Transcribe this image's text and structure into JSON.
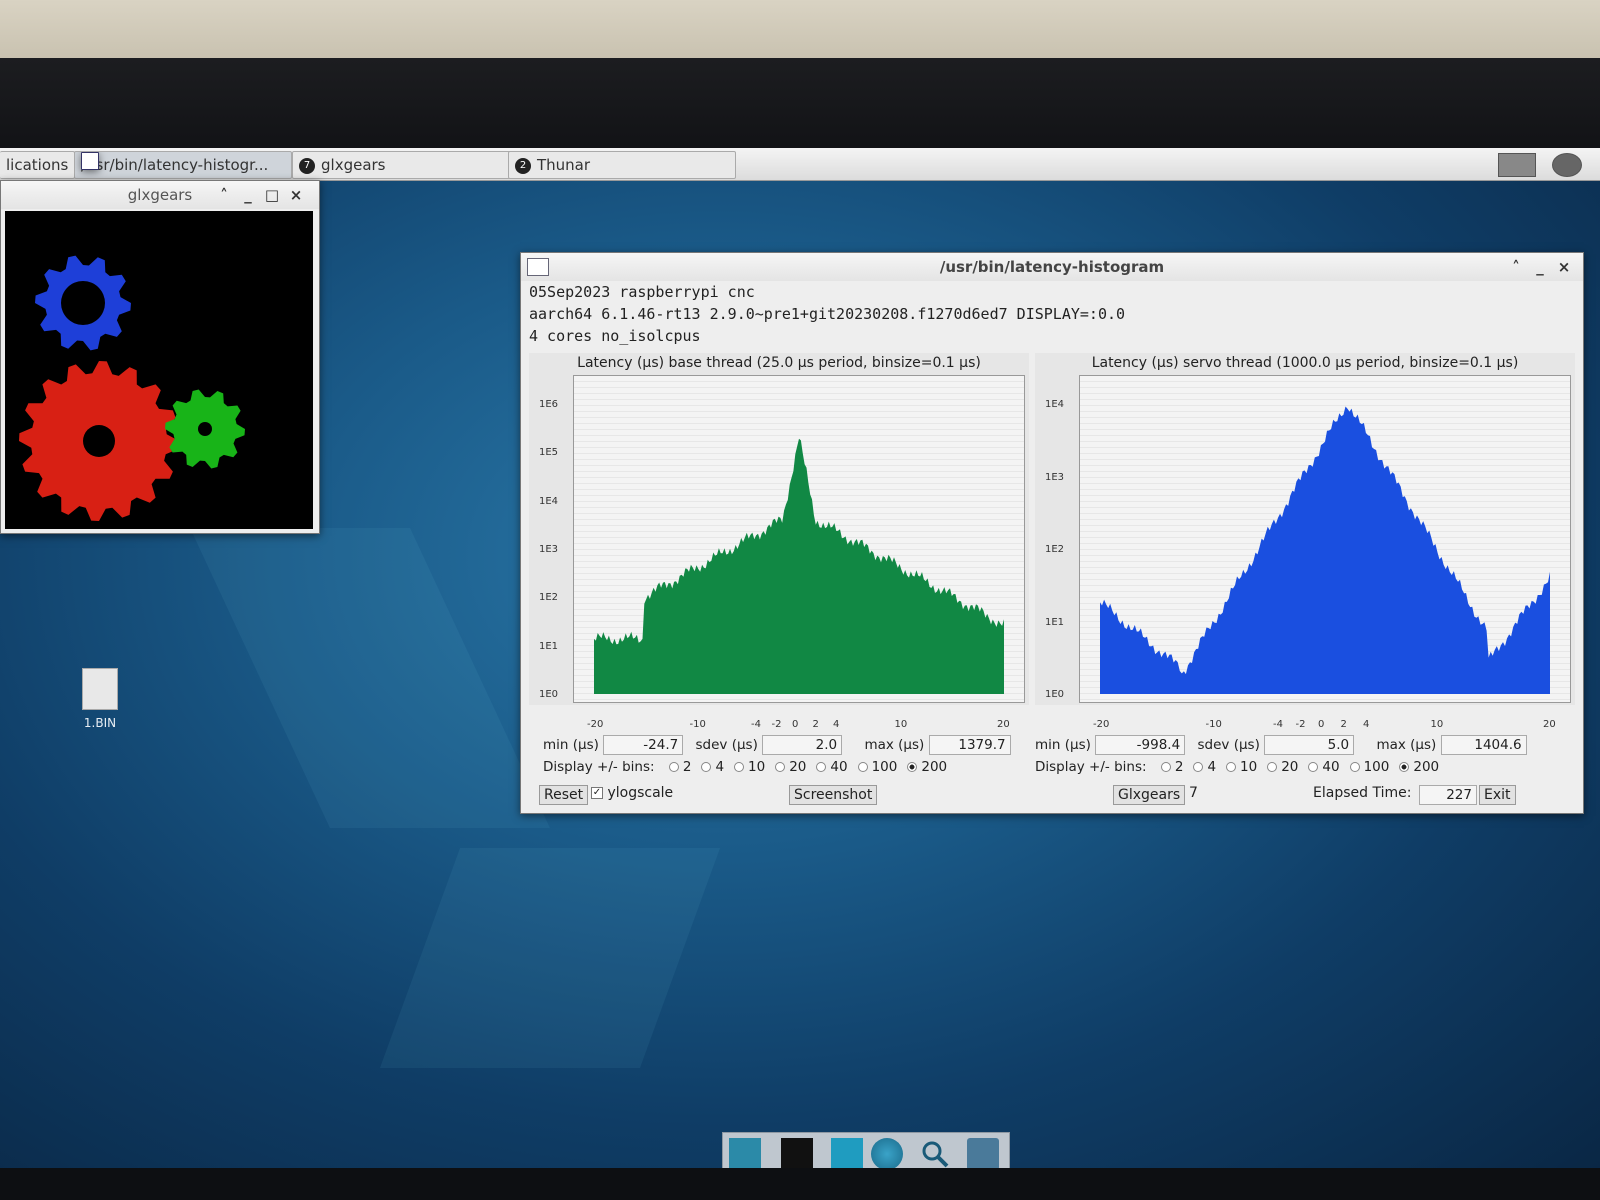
{
  "taskbar": {
    "apps_label": "lications",
    "tasks": [
      {
        "label": "/usr/bin/latency-histogr...",
        "badge": ""
      },
      {
        "label": "glxgears",
        "badge": "7"
      },
      {
        "label": "Thunar",
        "badge": "2"
      }
    ]
  },
  "glxgears": {
    "title": "glxgears",
    "gears": [
      {
        "color": "#1e3fd8"
      },
      {
        "color": "#d82014"
      },
      {
        "color": "#18b418"
      }
    ]
  },
  "desktop": {
    "icons": [
      {
        "label": "1.BIN"
      }
    ]
  },
  "latency": {
    "title": "/usr/bin/latency-histogram",
    "info_line1": "05Sep2023 raspberrypi cnc",
    "info_line2": "aarch64  6.1.46-rt13  2.9.0~pre1+git20230208.f1270d6ed7  DISPLAY=:0.0",
    "info_line3": "4 cores  no_isolcpus",
    "base": {
      "title": "Latency (µs) base thread (25.0 µs period, binsize=0.1 µs)",
      "color": "#118844",
      "yticks": [
        "1E6",
        "1E5",
        "1E4",
        "1E3",
        "1E2",
        "1E1",
        "1E0"
      ],
      "xticks": [
        "-20",
        "-10",
        "-4",
        "-2",
        "0",
        "2",
        "4",
        "10",
        "20"
      ],
      "min_label": "min (µs)",
      "min": "-24.7",
      "sdev_label": "sdev (µs)",
      "sdev": "2.0",
      "max_label": "max (µs)",
      "max": "1379.7",
      "bins_label": "Display +/- bins:",
      "bins": [
        "2",
        "4",
        "10",
        "20",
        "40",
        "100",
        "200"
      ],
      "selected_bin": "200"
    },
    "servo": {
      "title": "Latency (µs) servo thread (1000.0 µs period, binsize=0.1 µs)",
      "color": "#1a4fe0",
      "yticks": [
        "1E4",
        "1E3",
        "1E2",
        "1E1",
        "1E0"
      ],
      "xticks": [
        "-20",
        "-10",
        "-4",
        "-2",
        "0",
        "2",
        "4",
        "10",
        "20"
      ],
      "min_label": "min (µs)",
      "min": "-998.4",
      "sdev_label": "sdev (µs)",
      "sdev": "5.0",
      "max_label": "max (µs)",
      "max": "1404.6",
      "bins_label": "Display +/- bins:",
      "bins": [
        "2",
        "4",
        "10",
        "20",
        "40",
        "100",
        "200"
      ],
      "selected_bin": "200"
    },
    "bottom": {
      "reset": "Reset",
      "ylogscale": "ylogscale",
      "ylogscale_checked": true,
      "screenshot": "Screenshot",
      "glxgears_btn": "Glxgears",
      "glxgears_count": "7",
      "elapsed_label": "Elapsed Time:",
      "elapsed": "227",
      "exit": "Exit"
    }
  }
}
